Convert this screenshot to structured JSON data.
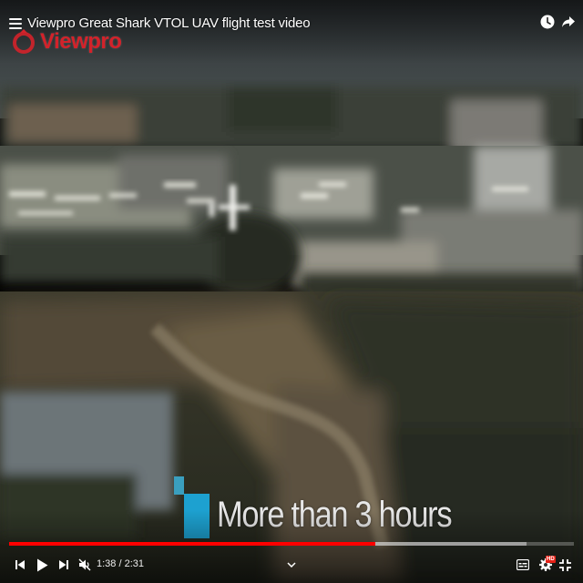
{
  "title_bar": {
    "title": "Viewpro Great Shark VTOL UAV flight test video",
    "menu_icon": "hamburger-icon",
    "watch_later_icon": "clock-icon",
    "share_icon": "share-arrow-icon"
  },
  "watermark": {
    "text": "Viewpro",
    "color": "#d3222a"
  },
  "caption": {
    "text": "More than 3 hours",
    "accent_color": "#1da1d0"
  },
  "player": {
    "time_current": "1:38",
    "time_separator": " / ",
    "time_total": "2:31",
    "played_fraction": 0.649,
    "buffered_fraction": 0.916,
    "progress_color": "#ff0000",
    "hd_badge": "HD",
    "controls": {
      "previous": "skip-previous-icon",
      "play": "play-icon",
      "next": "skip-next-icon",
      "volume": "volume-muted-icon",
      "more": "chevron-down-icon",
      "subtitles": "subtitles-icon",
      "settings": "gear-icon",
      "fullscreen": "exit-fullscreen-icon"
    }
  }
}
